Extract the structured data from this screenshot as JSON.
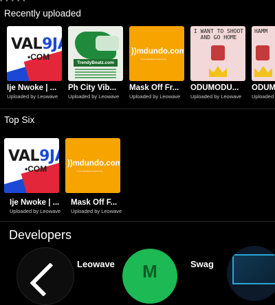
{
  "top_dots": "• • • • •",
  "recently_uploaded": {
    "title": "Recently uploaded",
    "items": [
      {
        "title": "Ije Nwoke | ...",
        "sub": "Uploaded by Leowave",
        "art": "valgja"
      },
      {
        "title": "Ph City Vib...",
        "sub": "Uploaded by Leowave",
        "art": "trendy"
      },
      {
        "title": "Mask Off Fr...",
        "sub": "Uploaded by Leowave",
        "art": "mdundo"
      },
      {
        "title": "ODUMODU...",
        "sub": "Uploaded by Leowave",
        "art": "odumodu"
      },
      {
        "title": "ODUM",
        "sub": "Uploaded",
        "art": "odumodu2"
      }
    ]
  },
  "top_six": {
    "title": "Top Six",
    "items": [
      {
        "title": "Ije Nwoke | ...",
        "sub": "Uploaded by Leowave",
        "art": "valgja"
      },
      {
        "title": "Mask Off F...",
        "sub": "Uploaded by Leowave",
        "art": "mdundo"
      }
    ]
  },
  "developers": {
    "title": "Developers",
    "items": [
      {
        "name": "Leowave",
        "avatar": "leowave-logo"
      },
      {
        "name": "Swag",
        "avatar_letter": "M"
      }
    ]
  },
  "art_text": {
    "valgja_word_a": "VAL",
    "valgja_word_b": "9JA",
    "valgja_dotcom": "•COM",
    "trendy_tag": "TrendyBeatz.com",
    "mdundo_logo": "))mdundo.com",
    "mdundo_tiny": "music download & streaming",
    "odu_text": "I WANT TO SHOOT AND GO HOME",
    "odu_text2": "HAMM"
  },
  "colors": {
    "background": "#000000",
    "mdundo_orange": "#f7a300",
    "valgja_blue": "#1b49d6",
    "valgja_red": "#e4263a",
    "dev_green": "#1db954"
  }
}
